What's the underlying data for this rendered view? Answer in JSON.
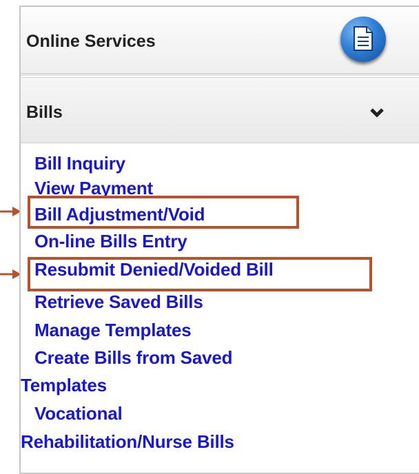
{
  "header": {
    "title": "Online Services",
    "icon": "document-icon"
  },
  "section": {
    "title": "Bills",
    "toggle_icon": "chevron-down-icon"
  },
  "links": [
    {
      "label": "Bill Inquiry"
    },
    {
      "label": "View Payment"
    },
    {
      "label": "Bill Adjustment/Void",
      "highlighted": true
    },
    {
      "label": "On-line Bills Entry"
    },
    {
      "label": "Resubmit Denied/Voided Bill",
      "highlighted": true
    },
    {
      "label": "Retrieve Saved Bills"
    },
    {
      "label": "Manage Templates"
    },
    {
      "label_line1": "Create Bills from Saved",
      "label_line2": "Templates"
    },
    {
      "label_line1": "Vocational",
      "label_line2": "Rehabilitation/Nurse Bills"
    }
  ],
  "annotation_color": "#b5542c"
}
